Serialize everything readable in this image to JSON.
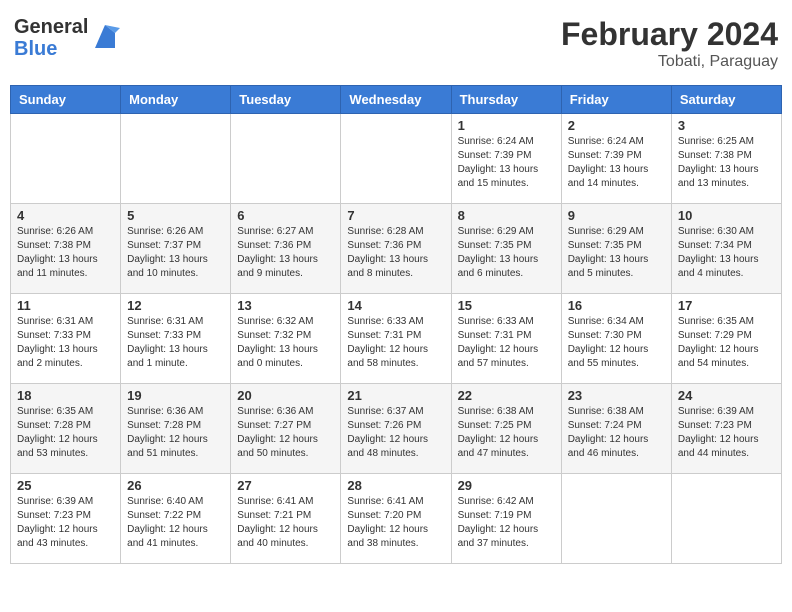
{
  "header": {
    "logo_general": "General",
    "logo_blue": "Blue",
    "month_title": "February 2024",
    "location": "Tobati, Paraguay"
  },
  "days_of_week": [
    "Sunday",
    "Monday",
    "Tuesday",
    "Wednesday",
    "Thursday",
    "Friday",
    "Saturday"
  ],
  "weeks": [
    [
      {
        "day": "",
        "info": ""
      },
      {
        "day": "",
        "info": ""
      },
      {
        "day": "",
        "info": ""
      },
      {
        "day": "",
        "info": ""
      },
      {
        "day": "1",
        "info": "Sunrise: 6:24 AM\nSunset: 7:39 PM\nDaylight: 13 hours and 15 minutes."
      },
      {
        "day": "2",
        "info": "Sunrise: 6:24 AM\nSunset: 7:39 PM\nDaylight: 13 hours and 14 minutes."
      },
      {
        "day": "3",
        "info": "Sunrise: 6:25 AM\nSunset: 7:38 PM\nDaylight: 13 hours and 13 minutes."
      }
    ],
    [
      {
        "day": "4",
        "info": "Sunrise: 6:26 AM\nSunset: 7:38 PM\nDaylight: 13 hours and 11 minutes."
      },
      {
        "day": "5",
        "info": "Sunrise: 6:26 AM\nSunset: 7:37 PM\nDaylight: 13 hours and 10 minutes."
      },
      {
        "day": "6",
        "info": "Sunrise: 6:27 AM\nSunset: 7:36 PM\nDaylight: 13 hours and 9 minutes."
      },
      {
        "day": "7",
        "info": "Sunrise: 6:28 AM\nSunset: 7:36 PM\nDaylight: 13 hours and 8 minutes."
      },
      {
        "day": "8",
        "info": "Sunrise: 6:29 AM\nSunset: 7:35 PM\nDaylight: 13 hours and 6 minutes."
      },
      {
        "day": "9",
        "info": "Sunrise: 6:29 AM\nSunset: 7:35 PM\nDaylight: 13 hours and 5 minutes."
      },
      {
        "day": "10",
        "info": "Sunrise: 6:30 AM\nSunset: 7:34 PM\nDaylight: 13 hours and 4 minutes."
      }
    ],
    [
      {
        "day": "11",
        "info": "Sunrise: 6:31 AM\nSunset: 7:33 PM\nDaylight: 13 hours and 2 minutes."
      },
      {
        "day": "12",
        "info": "Sunrise: 6:31 AM\nSunset: 7:33 PM\nDaylight: 13 hours and 1 minute."
      },
      {
        "day": "13",
        "info": "Sunrise: 6:32 AM\nSunset: 7:32 PM\nDaylight: 13 hours and 0 minutes."
      },
      {
        "day": "14",
        "info": "Sunrise: 6:33 AM\nSunset: 7:31 PM\nDaylight: 12 hours and 58 minutes."
      },
      {
        "day": "15",
        "info": "Sunrise: 6:33 AM\nSunset: 7:31 PM\nDaylight: 12 hours and 57 minutes."
      },
      {
        "day": "16",
        "info": "Sunrise: 6:34 AM\nSunset: 7:30 PM\nDaylight: 12 hours and 55 minutes."
      },
      {
        "day": "17",
        "info": "Sunrise: 6:35 AM\nSunset: 7:29 PM\nDaylight: 12 hours and 54 minutes."
      }
    ],
    [
      {
        "day": "18",
        "info": "Sunrise: 6:35 AM\nSunset: 7:28 PM\nDaylight: 12 hours and 53 minutes."
      },
      {
        "day": "19",
        "info": "Sunrise: 6:36 AM\nSunset: 7:28 PM\nDaylight: 12 hours and 51 minutes."
      },
      {
        "day": "20",
        "info": "Sunrise: 6:36 AM\nSunset: 7:27 PM\nDaylight: 12 hours and 50 minutes."
      },
      {
        "day": "21",
        "info": "Sunrise: 6:37 AM\nSunset: 7:26 PM\nDaylight: 12 hours and 48 minutes."
      },
      {
        "day": "22",
        "info": "Sunrise: 6:38 AM\nSunset: 7:25 PM\nDaylight: 12 hours and 47 minutes."
      },
      {
        "day": "23",
        "info": "Sunrise: 6:38 AM\nSunset: 7:24 PM\nDaylight: 12 hours and 46 minutes."
      },
      {
        "day": "24",
        "info": "Sunrise: 6:39 AM\nSunset: 7:23 PM\nDaylight: 12 hours and 44 minutes."
      }
    ],
    [
      {
        "day": "25",
        "info": "Sunrise: 6:39 AM\nSunset: 7:23 PM\nDaylight: 12 hours and 43 minutes."
      },
      {
        "day": "26",
        "info": "Sunrise: 6:40 AM\nSunset: 7:22 PM\nDaylight: 12 hours and 41 minutes."
      },
      {
        "day": "27",
        "info": "Sunrise: 6:41 AM\nSunset: 7:21 PM\nDaylight: 12 hours and 40 minutes."
      },
      {
        "day": "28",
        "info": "Sunrise: 6:41 AM\nSunset: 7:20 PM\nDaylight: 12 hours and 38 minutes."
      },
      {
        "day": "29",
        "info": "Sunrise: 6:42 AM\nSunset: 7:19 PM\nDaylight: 12 hours and 37 minutes."
      },
      {
        "day": "",
        "info": ""
      },
      {
        "day": "",
        "info": ""
      }
    ]
  ]
}
